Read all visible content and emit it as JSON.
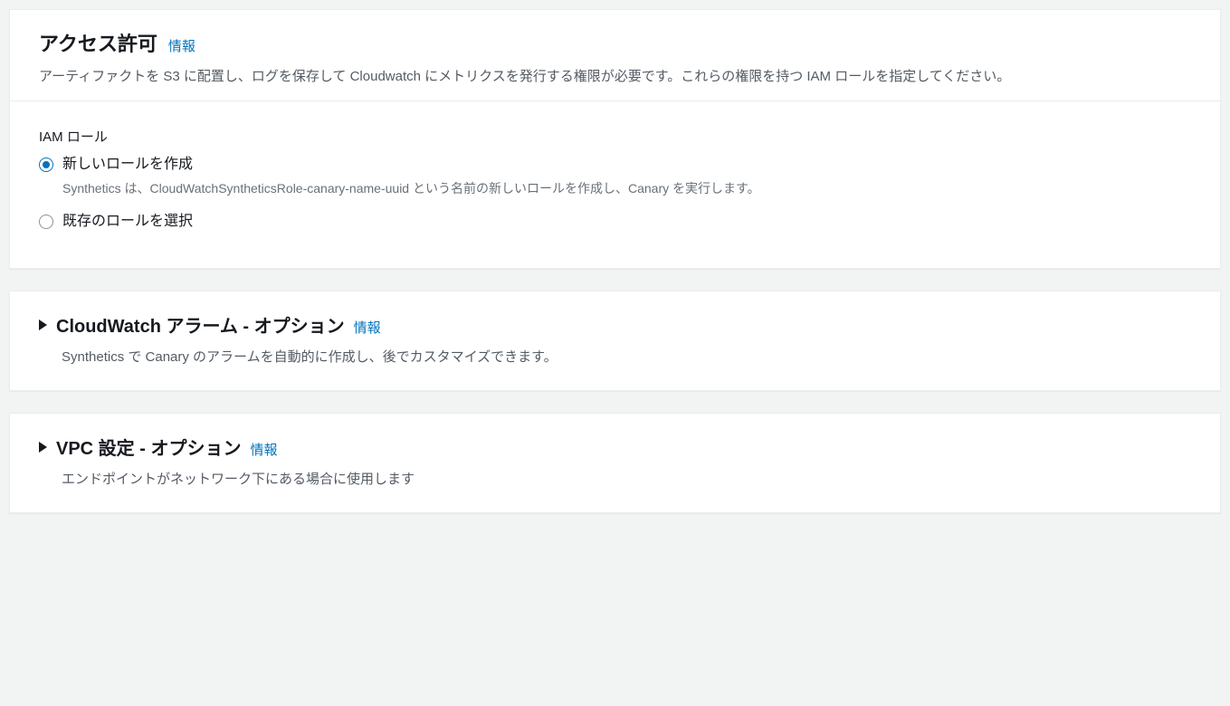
{
  "permissions": {
    "title": "アクセス許可",
    "info": "情報",
    "description": "アーティファクトを S3 に配置し、ログを保存して Cloudwatch にメトリクスを発行する権限が必要です。これらの権限を持つ IAM ロールを指定してください。",
    "iam_role_label": "IAM ロール",
    "options": [
      {
        "label": "新しいロールを作成",
        "description": "Synthetics は、CloudWatchSyntheticsRole-canary-name-uuid という名前の新しいロールを作成し、Canary を実行します。",
        "selected": true
      },
      {
        "label": "既存のロールを選択",
        "description": "",
        "selected": false
      }
    ]
  },
  "alarms": {
    "title": "CloudWatch アラーム - オプション",
    "info": "情報",
    "description": "Synthetics で Canary のアラームを自動的に作成し、後でカスタマイズできます。"
  },
  "vpc": {
    "title": "VPC 設定 - オプション",
    "info": "情報",
    "description": "エンドポイントがネットワーク下にある場合に使用します"
  }
}
